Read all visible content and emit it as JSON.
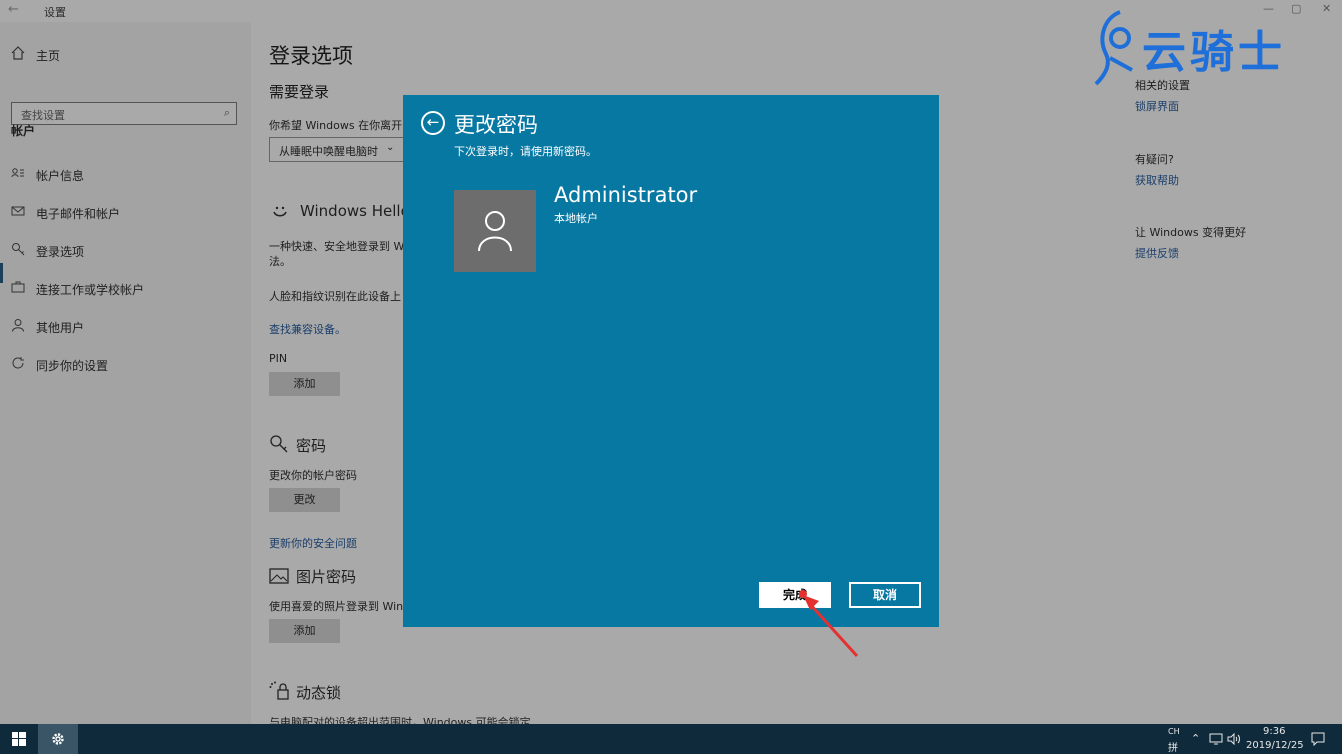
{
  "window": {
    "back_glyph": "←",
    "title": "设置",
    "min": "—",
    "max": "▢",
    "close": "✕"
  },
  "sidebar": {
    "home": "主页",
    "search_placeholder": "查找设置",
    "section": "帐户",
    "items": [
      {
        "icon": "person-card-icon",
        "label": "帐户信息"
      },
      {
        "icon": "mail-icon",
        "label": "电子邮件和帐户"
      },
      {
        "icon": "key-icon",
        "label": "登录选项"
      },
      {
        "icon": "briefcase-icon",
        "label": "连接工作或学校帐户"
      },
      {
        "icon": "person-icon",
        "label": "其他用户"
      },
      {
        "icon": "sync-icon",
        "label": "同步你的设置"
      }
    ]
  },
  "main": {
    "page_title": "登录选项",
    "require_signin": "需要登录",
    "away_text": "你希望 Windows 在你离开电",
    "away_select": "从睡眠中唤醒电脑时",
    "hello_title": "Windows Hello",
    "hello_desc_1": "一种快速、安全地登录到 W",
    "hello_desc_2": "法。",
    "face_text": "人脸和指纹识别在此设备上",
    "compat_link": "查找兼容设备。",
    "pin_label": "PIN",
    "pin_add": "添加",
    "password_title": "密码",
    "password_desc": "更改你的帐户密码",
    "password_change": "更改",
    "security_link": "更新你的安全问题",
    "picture_title": "图片密码",
    "picture_desc": "使用喜爱的照片登录到 Win",
    "picture_add": "添加",
    "dynamic_title": "动态锁",
    "dynamic_desc": "与电脑配对的设备超出范围时，Windows 可能会锁定"
  },
  "right": {
    "related": "相关的设置",
    "lockscreen": "锁屏界面",
    "question": "有疑问?",
    "help": "获取帮助",
    "better": "让 Windows 变得更好",
    "feedback": "提供反馈"
  },
  "watermark": "云骑士",
  "dialog": {
    "title": "更改密码",
    "subtitle": "下次登录时，请使用新密码。",
    "user_name": "Administrator",
    "user_type": "本地帐户",
    "done": "完成",
    "cancel": "取消",
    "bg_color": "#0778a2"
  },
  "taskbar": {
    "ime_top": "CH",
    "ime_bottom": "拼",
    "time": "9:36",
    "date": "2019/12/25"
  }
}
